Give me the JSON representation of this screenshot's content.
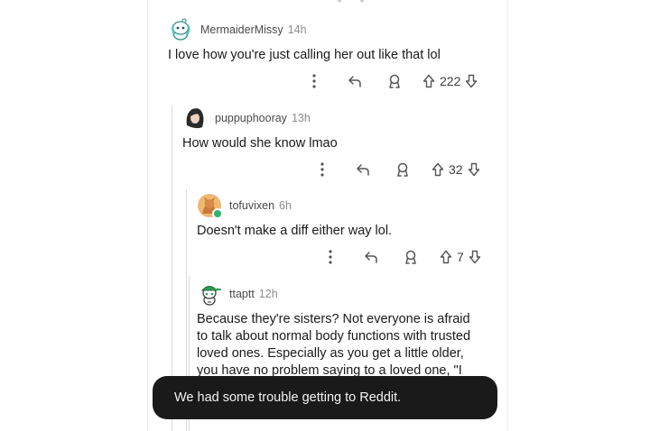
{
  "comments": [
    {
      "username": "MermaiderMissy",
      "age": "14h",
      "body": "I love how you're just calling her out like that lol",
      "score": "222",
      "avatar": "snoo-mermaid-avatar"
    },
    {
      "username": "puppuphooray",
      "age": "13h",
      "body": "How would she know lmao",
      "score": "32",
      "avatar": "dark-hair-avatar"
    },
    {
      "username": "tofuvixen",
      "age": "6h",
      "body": "Doesn't make a diff either way lol.",
      "score": "7",
      "avatar": "fox-avatar",
      "online": true
    },
    {
      "username": "ttaptt",
      "age": "12h",
      "body_lines": [
        "Because they're sisters? Not everyone is afraid",
        "to talk about normal body functions with trusted",
        "loved ones. Especially as you get a little older,",
        "you have no problem saying to a loved one, \"I"
      ],
      "avatar": "snoo-green-cap-avatar"
    }
  ],
  "icons": {
    "more": "more-vertical-icon",
    "reply": "reply-arrow-icon",
    "award": "award-icon",
    "upvote": "upvote-arrow-icon",
    "downvote": "downvote-arrow-icon"
  },
  "toast": {
    "message": "We had some trouble getting to Reddit."
  },
  "colors": {
    "toast_bg": "#1a1a1b",
    "thread_line": "#dcdcdc",
    "online": "#2db46e"
  }
}
